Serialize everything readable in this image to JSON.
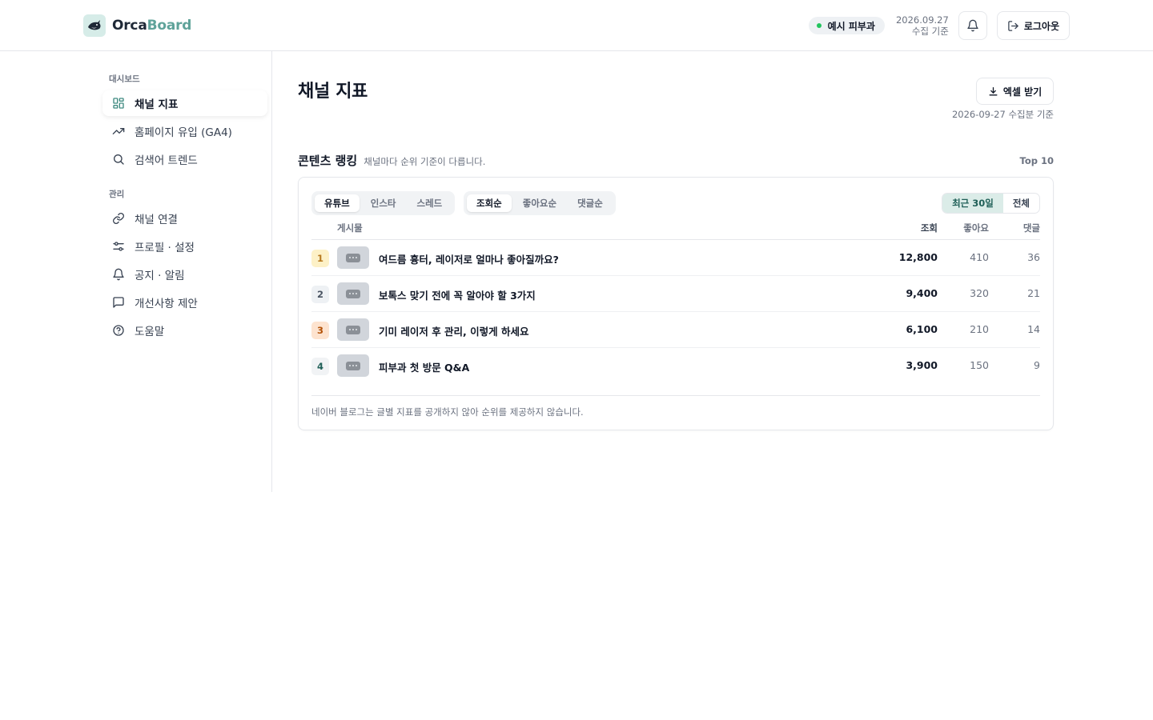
{
  "brand": {
    "name_part1": "Orca",
    "name_part2": "Board"
  },
  "header": {
    "clinic": "예시 피부과",
    "date": "2026.09.27",
    "date_note": "수집 기준",
    "logout_label": "로그아웃"
  },
  "sidebar": {
    "sections": [
      {
        "label": "대시보드",
        "items": [
          {
            "label": "채널 지표",
            "icon": "grid-icon",
            "active": true
          },
          {
            "label": "홈페이지 유입 (GA4)",
            "icon": "trending-up-icon"
          },
          {
            "label": "검색어 트렌드",
            "icon": "search-icon"
          }
        ]
      },
      {
        "label": "관리",
        "items": [
          {
            "label": "채널 연결",
            "icon": "link-icon"
          },
          {
            "label": "프로필 · 설정",
            "icon": "sliders-icon"
          },
          {
            "label": "공지 · 알림",
            "icon": "bell-icon"
          },
          {
            "label": "개선사항 제안",
            "icon": "message-icon"
          },
          {
            "label": "도움말",
            "icon": "help-circle-icon"
          }
        ]
      }
    ]
  },
  "main": {
    "title": "채널 지표",
    "excel_label": "엑셀 받기",
    "as_of": "2026-09-27 수집분 기준",
    "ranking": {
      "title": "콘텐츠 랭킹",
      "subtitle": "채널마다 순위 기준이 다릅니다.",
      "top_label": "Top 10",
      "channel_tabs": [
        "유튜브",
        "인스타",
        "스레드"
      ],
      "channel_selected": "유튜브",
      "sort_tabs": [
        "조회순",
        "좋아요순",
        "댓글순"
      ],
      "sort_selected": "조회순",
      "period_tabs": [
        "최근 30일",
        "전체"
      ],
      "period_selected": "최근 30일",
      "columns": {
        "post": "게시물",
        "views": "조회",
        "likes": "좋아요",
        "comments": "댓글"
      },
      "rows": [
        {
          "rank": "1",
          "title": "여드름 흉터, 레이저로 얼마나 좋아질까요?",
          "views": "12,800",
          "likes": "410",
          "comments": "36"
        },
        {
          "rank": "2",
          "title": "보톡스 맞기 전에 꼭 알아야 할 3가지",
          "views": "9,400",
          "likes": "320",
          "comments": "21"
        },
        {
          "rank": "3",
          "title": "기미 레이저 후 관리, 이렇게 하세요",
          "views": "6,100",
          "likes": "210",
          "comments": "14"
        },
        {
          "rank": "4",
          "title": "피부과 첫 방문 Q&A",
          "views": "3,900",
          "likes": "150",
          "comments": "9"
        }
      ],
      "rank_colors": [
        {
          "bg": "#fdf1c7",
          "fg": "#b7791f"
        },
        {
          "bg": "#eef1f4",
          "fg": "#4b5563"
        },
        {
          "bg": "#fde3cf",
          "fg": "#b45309"
        },
        {
          "bg": "#f1f3f5",
          "fg": "#1f5f57"
        }
      ],
      "footnote": "네이버 블로그는 글별 지표를 공개하지 않아 순위를 제공하지 않습니다."
    }
  },
  "colors": {
    "accent": "#5fa39a",
    "status_dot": "#22c55e",
    "period_selected_bg": "#dbece8"
  }
}
